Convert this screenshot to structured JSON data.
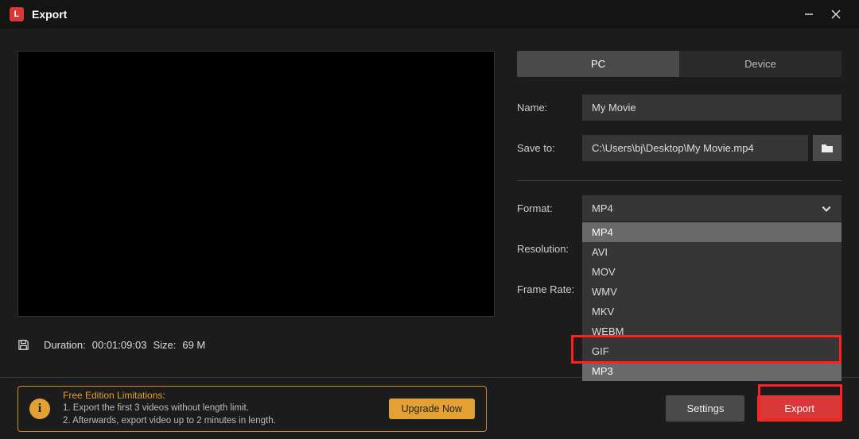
{
  "window": {
    "title": "Export"
  },
  "preview": {
    "duration_label": "Duration:",
    "duration_value": "00:01:09:03",
    "size_label": "Size:",
    "size_value": "69 M"
  },
  "tabs": {
    "pc": "PC",
    "device": "Device"
  },
  "fields": {
    "name_label": "Name:",
    "name_value": "My Movie",
    "saveto_label": "Save to:",
    "saveto_value": "C:\\Users\\bj\\Desktop\\My Movie.mp4",
    "format_label": "Format:",
    "format_value": "MP4",
    "resolution_label": "Resolution:",
    "framerate_label": "Frame Rate:"
  },
  "format_options": {
    "o0": "MP4",
    "o1": "AVI",
    "o2": "MOV",
    "o3": "WMV",
    "o4": "MKV",
    "o5": "WEBM",
    "o6": "GIF",
    "o7": "MP3"
  },
  "limits": {
    "title": "Free Edition Limitations:",
    "line1": "1. Export the first 3 videos without length limit.",
    "line2": "2. Afterwards, export video up to 2 minutes in length.",
    "upgrade": "Upgrade Now"
  },
  "buttons": {
    "settings": "Settings",
    "export": "Export"
  }
}
